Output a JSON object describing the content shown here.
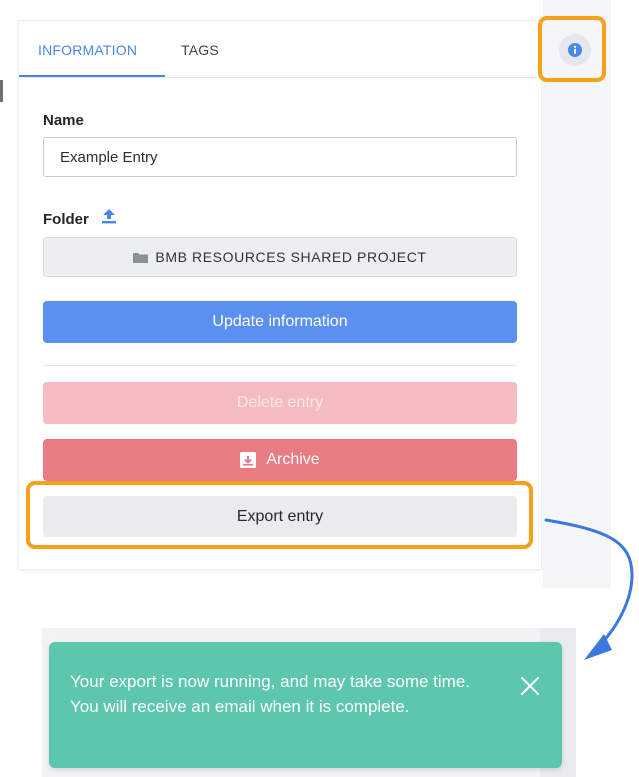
{
  "tabs": [
    {
      "label": "INFORMATION",
      "active": true
    },
    {
      "label": "TAGS",
      "active": false
    }
  ],
  "name_field": {
    "label": "Name",
    "value": "Example Entry"
  },
  "folder_field": {
    "label": "Folder",
    "value": "BMB RESOURCES SHARED PROJECT",
    "icon": "folder-icon",
    "upload_icon": "upload-icon"
  },
  "buttons": {
    "update": "Update information",
    "delete": "Delete entry",
    "archive": "Archive",
    "export": "Export entry"
  },
  "info_button": {
    "icon": "info-icon"
  },
  "toast": {
    "message": "Your export is now running, and may take some time. You will receive an email when it is complete.",
    "close_icon": "close-icon"
  },
  "colors": {
    "primary": "#5b8ff0",
    "tab_active": "#4a86e8",
    "danger_disabled": "#f4bcc0",
    "danger": "#e97c82",
    "highlight": "#f7a01c",
    "toast": "#5cc6af",
    "annotation_arrow": "#3a78e0"
  }
}
